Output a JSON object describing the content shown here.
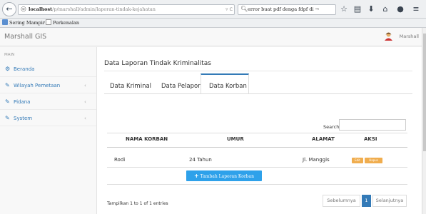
{
  "browser": {
    "url_host": "localhost",
    "url_path": "/p/marshall/admin/laporan-tindak-kejahatan",
    "search_query": "error buat pdf denga fdpf di",
    "search_arrow": "→",
    "bookmarks": [
      "Sering Mampir",
      "Perkenalan"
    ]
  },
  "app": {
    "brand": "Marshall GIS",
    "user_name": "Marshall"
  },
  "sidebar": {
    "heading": "MAIN",
    "items": [
      {
        "label": "Beranda",
        "icon": "dashboard-icon",
        "has_caret": false
      },
      {
        "label": "Wilayah Pemetaan",
        "icon": "edit-icon",
        "has_caret": true
      },
      {
        "label": "Pidana",
        "icon": "edit-icon",
        "has_caret": true
      },
      {
        "label": "System",
        "icon": "edit-icon",
        "has_caret": true
      }
    ],
    "caret": "‹"
  },
  "main": {
    "title": "Data Laporan Tindak Kriminalitas",
    "tabs": [
      "Data Kriminal",
      "Data Pelapor",
      "Data Korban"
    ],
    "active_tab": "Data Korban",
    "search_label": "Search:",
    "search_value": "",
    "table": {
      "headers": [
        "NAMA KORBAN",
        "UMUR",
        "ALAMAT",
        "AKSI"
      ],
      "rows": [
        {
          "nama": "Rodi",
          "umur": "24 Tahun",
          "alamat": "Jl. Manggis",
          "edit": "Edit",
          "hapus": "Hapus"
        }
      ]
    },
    "add_button": "Tambah Laporan Korban",
    "info": "Tampilkan 1 to 1 of 1 entries",
    "pager": {
      "prev": "Sebelumnya",
      "page": "1",
      "next": "Selanjutnya"
    }
  },
  "colors": {
    "primary": "#337ab7",
    "accent": "#2ea1ea",
    "warning": "#f0ad4e"
  }
}
